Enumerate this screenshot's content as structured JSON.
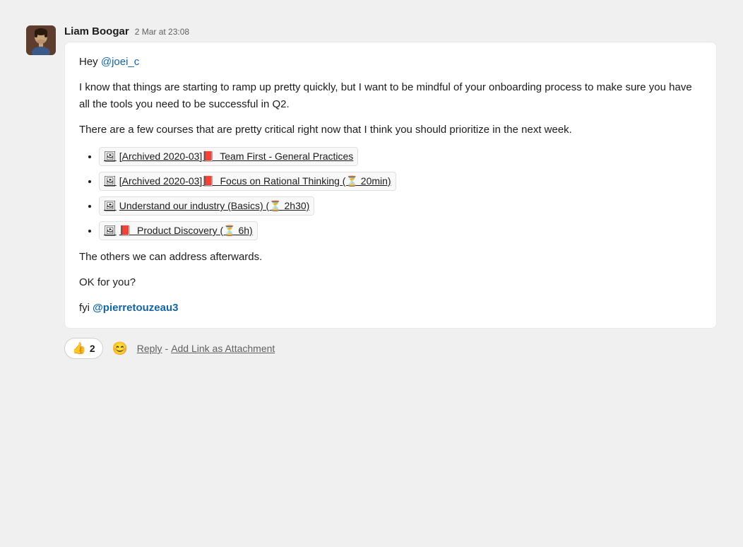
{
  "message": {
    "author": "Liam Boogar",
    "timestamp": "2 Mar at 23:08",
    "avatar_emoji": "👤",
    "paragraphs": {
      "greeting": "Hey ",
      "mention1": "@joei_c",
      "body1": "I know that things are starting to ramp up pretty quickly, but I want to be mindful of your onboarding process to make sure you have all the tools you need to be successful in Q2.",
      "body2": "There are a few courses that are pretty critical right now that I think you should prioritize in the next week.",
      "body3": "The others we can address afterwards.",
      "body4": "OK for you?",
      "fyi_prefix": "fyi ",
      "mention2": "@pierretouzeau3"
    },
    "courses": [
      {
        "icon1": "🖼",
        "icon2": "📕",
        "text": "[Archived 2020-03]📕  Team First - General Practices"
      },
      {
        "icon1": "🖼",
        "icon2": "📕",
        "text": "[Archived 2020-03]📕  Focus on Rational Thinking (⏳ 20min)"
      },
      {
        "icon1": "🖼",
        "text": "Understand our industry (Basics) (⏳ 2h30)"
      },
      {
        "icon1": "🖼",
        "icon2": "📕",
        "text": "Product Discovery (⏳ 6h)"
      }
    ],
    "actions": {
      "reaction_emoji": "👍",
      "reaction_count": "2",
      "emoji_add": "😊",
      "reply_label": "Reply",
      "separator": " - ",
      "add_link_label": "Add Link as Attachment"
    }
  }
}
